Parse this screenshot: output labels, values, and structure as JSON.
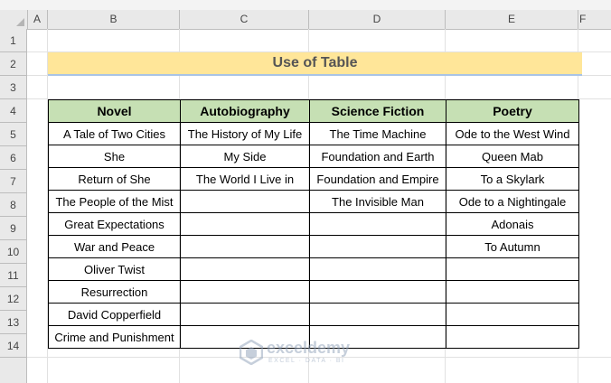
{
  "columns": [
    "A",
    "B",
    "C",
    "D",
    "E",
    "F"
  ],
  "rows": [
    "1",
    "2",
    "3",
    "4",
    "5",
    "6",
    "7",
    "8",
    "9",
    "10",
    "11",
    "12",
    "13",
    "14"
  ],
  "title": "Use of Table",
  "table": {
    "headers": [
      "Novel",
      "Autobiography",
      "Science Fiction",
      "Poetry"
    ],
    "rows": [
      [
        "A Tale of Two Cities",
        "The History of My Life",
        "The Time Machine",
        "Ode to the West Wind"
      ],
      [
        "She",
        "My Side",
        "Foundation and Earth",
        "Queen Mab"
      ],
      [
        "Return of She",
        "The World I Live in",
        "Foundation and Empire",
        "To a Skylark"
      ],
      [
        "The People of the Mist",
        "",
        "The Invisible Man",
        "Ode to a Nightingale"
      ],
      [
        "Great Expectations",
        "",
        "",
        "Adonais"
      ],
      [
        "War and Peace",
        "",
        "",
        "To Autumn"
      ],
      [
        "Oliver Twist",
        "",
        "",
        ""
      ],
      [
        "Resurrection",
        "",
        "",
        ""
      ],
      [
        "David Copperfield",
        "",
        "",
        ""
      ],
      [
        "Crime and Punishment",
        "",
        "",
        ""
      ]
    ]
  },
  "watermark": {
    "brand": "exceldemy",
    "tagline": "EXCEL · DATA · BI"
  },
  "colors": {
    "header_bg": "#c6e0b4",
    "title_bg": "#ffe699",
    "title_border": "#a9c4e6"
  }
}
